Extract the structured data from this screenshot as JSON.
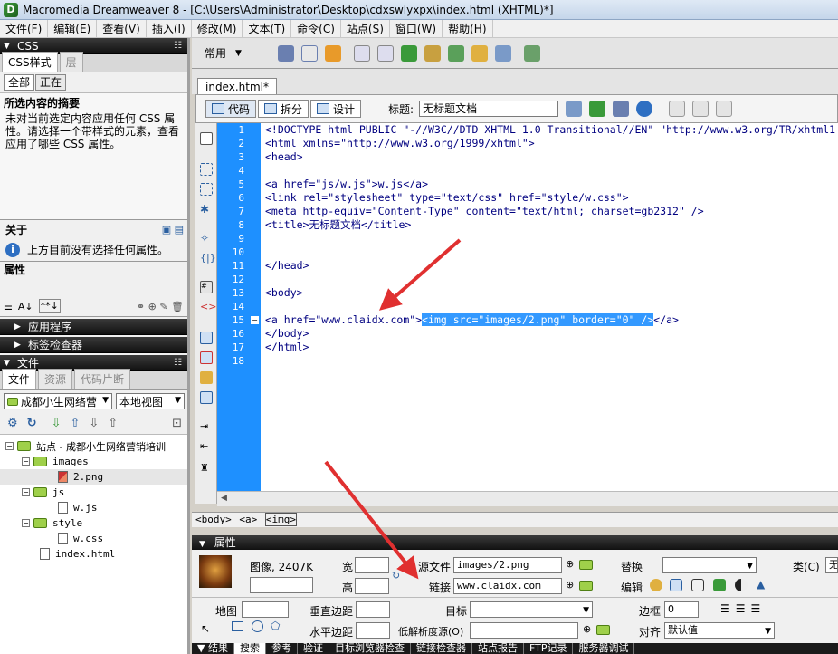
{
  "window": {
    "title": "Macromedia Dreamweaver 8 - [C:\\Users\\Administrator\\Desktop\\cdxswlyxpx\\index.html (XHTML)*]"
  },
  "menu": [
    "文件(F)",
    "编辑(E)",
    "查看(V)",
    "插入(I)",
    "修改(M)",
    "文本(T)",
    "命令(C)",
    "站点(S)",
    "窗口(W)",
    "帮助(H)"
  ],
  "css_panel": {
    "header": "CSS",
    "tabs": [
      "CSS样式",
      "层"
    ],
    "buttons": [
      "全部",
      "正在"
    ],
    "summary_title": "所选内容的摘要",
    "summary_text": "未对当前选定内容应用任何 CSS 属性。请选择一个带样式的元素，查看应用了哪些 CSS 属性。",
    "about_title": "关于",
    "about_text": "上方目前没有选择任何属性。",
    "props_title": "属性"
  },
  "collapsed_panels": [
    "应用程序",
    "标签检查器"
  ],
  "files_panel": {
    "header": "文件",
    "tabs": [
      "文件",
      "资源",
      "代码片断"
    ],
    "site_select": "成都小生网络营",
    "view_select": "本地视图",
    "tree": [
      {
        "label": "站点 - 成都小生网络营销培训",
        "type": "site",
        "level": 0
      },
      {
        "label": "images",
        "type": "folder",
        "level": 1
      },
      {
        "label": "2.png",
        "type": "image",
        "level": 2
      },
      {
        "label": "js",
        "type": "folder",
        "level": 1
      },
      {
        "label": "w.js",
        "type": "file",
        "level": 2
      },
      {
        "label": "style",
        "type": "folder",
        "level": 1
      },
      {
        "label": "w.css",
        "type": "file",
        "level": 2
      },
      {
        "label": "index.html",
        "type": "file",
        "level": 1
      }
    ]
  },
  "insert_bar": {
    "category": "常用"
  },
  "document": {
    "tab": "index.html*",
    "views": [
      "代码",
      "拆分",
      "设计"
    ],
    "title_label": "标题:",
    "title_value": "无标题文档",
    "line_numbers": [
      "1",
      "2",
      "3",
      "4",
      "5",
      "6",
      "7",
      "8",
      "9",
      "10",
      "11",
      "12",
      "13",
      "14",
      "15",
      "16",
      "17",
      "18"
    ],
    "code_lines": [
      "<!DOCTYPE html PUBLIC \"-//W3C//DTD XHTML 1.0 Transitional//EN\" \"http://www.w3.org/TR/xhtml1",
      "<html xmlns=\"http://www.w3.org/1999/xhtml\">",
      "<head>",
      "",
      "<a href=\"js/w.js\">w.js</a>",
      "<link rel=\"stylesheet\" type=\"text/css\" href=\"style/w.css\">",
      "<meta http-equiv=\"Content-Type\" content=\"text/html; charset=gb2312\" />",
      "<title>无标题文档</title>",
      "",
      "",
      "</head>",
      "",
      "<body>",
      "",
      "",
      "</body>",
      "</html>",
      ""
    ],
    "line15_before": "<a href=\"www.claidx.com\">",
    "line15_selected": "<img src=\"images/2.png\" border=\"0\" />",
    "line15_after": "</a>",
    "tag_selector": [
      "<body>",
      "<a>",
      "<img>"
    ]
  },
  "properties": {
    "header": "属性",
    "image_label": "图像, 2407K",
    "width_label": "宽",
    "height_label": "高",
    "src_label": "源文件",
    "src_value": "images/2.png",
    "link_label": "链接",
    "link_value": "www.claidx.com",
    "alt_label": "替换",
    "edit_label": "编辑",
    "class_label": "类(C)",
    "class_value": "无",
    "map_label": "地图",
    "vspace_label": "垂直边距",
    "target_label": "目标",
    "border_label": "边框",
    "border_value": "0",
    "hspace_label": "水平边距",
    "lowsrc_label": "低解析度源(O)",
    "align_label": "对齐",
    "align_value": "默认值"
  },
  "bottom_tabs": [
    "结果",
    "搜索",
    "参考",
    "验证",
    "目标浏览器检查",
    "链接检查器",
    "站点报告",
    "FTP记录",
    "服务器调试"
  ]
}
